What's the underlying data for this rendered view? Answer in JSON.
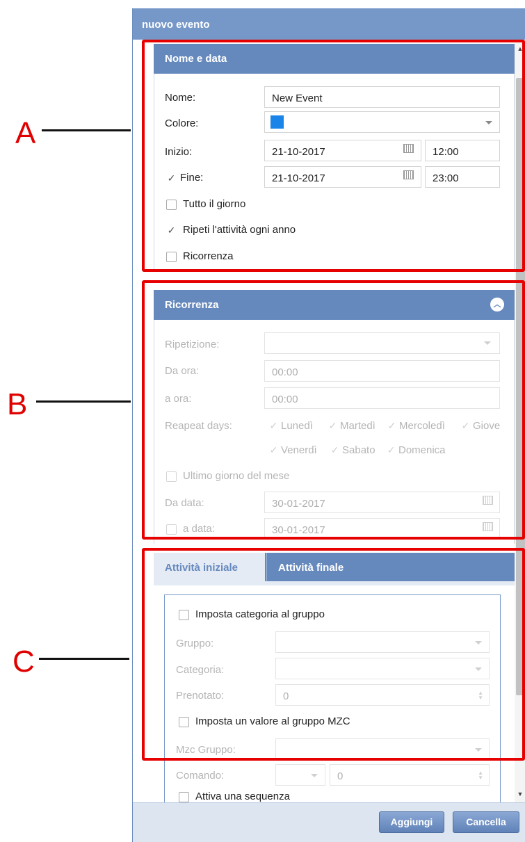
{
  "dialog": {
    "title": "nuovo evento"
  },
  "annotations": {
    "a": "A",
    "b": "B",
    "c": "C"
  },
  "panel_nome": {
    "header": "Nome e data",
    "nome_label": "Nome:",
    "nome_value": "New Event",
    "colore_label": "Colore:",
    "colore_value": "#1a84e8",
    "inizio_label": "Inizio:",
    "inizio_date": "21-10-2017",
    "inizio_time": "12:00",
    "fine_label": "Fine:",
    "fine_checked": true,
    "fine_date": "21-10-2017",
    "fine_time": "23:00",
    "tutto_label": "Tutto il giorno",
    "tutto_checked": false,
    "ripeti_label": "Ripeti l'attività ogni anno",
    "ripeti_checked": true,
    "ricorrenza_label": "Ricorrenza",
    "ricorrenza_checked": false
  },
  "panel_ricorrenza": {
    "header": "Ricorrenza",
    "ripetizione_label": "Ripetizione:",
    "ripetizione_value": "",
    "da_ora_label": "Da ora:",
    "da_ora_value": "00:00",
    "a_ora_label": "a ora:",
    "a_ora_value": "00:00",
    "days_label": "Reapeat days:",
    "days": [
      "Lunedì",
      "Martedì",
      "Mercoledì",
      "Giove",
      "Venerdì",
      "Sabato",
      "Domenica"
    ],
    "ultimo_label": "Ultimo giorno del mese",
    "da_data_label": "Da data:",
    "da_data_value": "30-01-2017",
    "a_data_label": "a data:",
    "a_data_value": "30-01-2017"
  },
  "tabs": {
    "items": [
      {
        "label": "Attività iniziale",
        "active": true
      },
      {
        "label": "Attività finale",
        "active": false
      }
    ],
    "imposta_cat_label": "Imposta categoria al gruppo",
    "gruppo_label": "Gruppo:",
    "categoria_label": "Categoria:",
    "prenotato_label": "Prenotato:",
    "prenotato_value": "0",
    "imposta_mzc_label": "Imposta un valore al gruppo MZC",
    "mzc_gruppo_label": "Mzc Gruppo:",
    "comando_label": "Comando:",
    "comando_value": "0",
    "attiva_label": "Attiva una sequenza"
  },
  "footer": {
    "add_label": "Aggiungi",
    "cancel_label": "Cancella"
  },
  "colors": {
    "header": "#6689bd",
    "title_bar": "#7698c9",
    "annotation": "#e60000"
  }
}
